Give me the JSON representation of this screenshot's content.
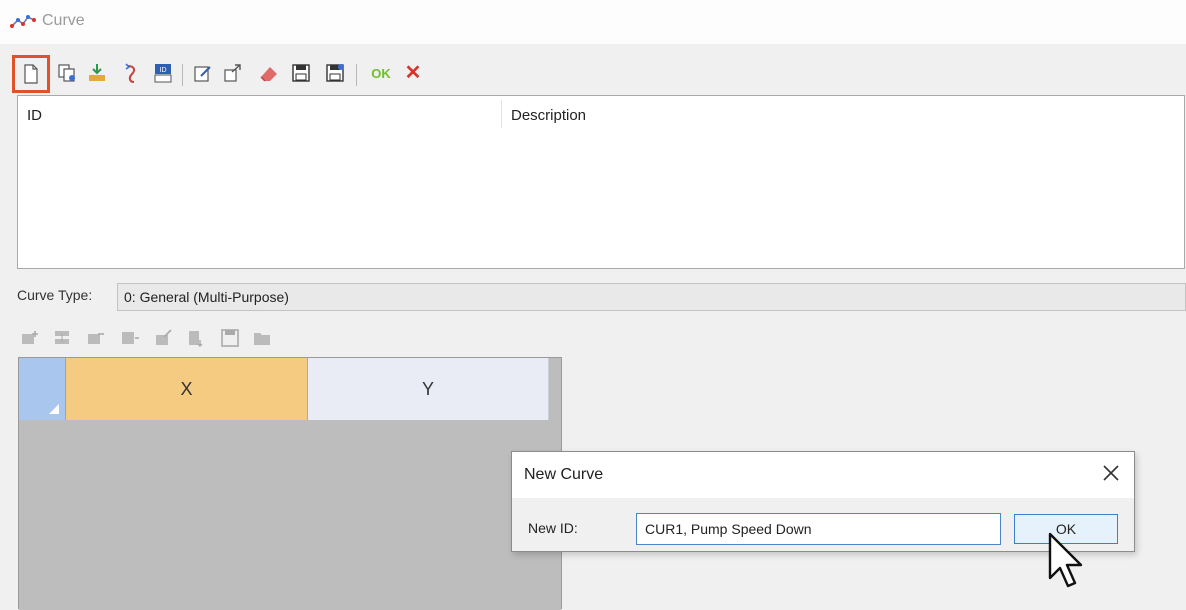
{
  "window": {
    "title": "Curve",
    "icon": "curve-chart-icon"
  },
  "toolbar": {
    "buttons": [
      {
        "name": "new-button",
        "icon": "new-document-icon"
      },
      {
        "name": "copy-button",
        "icon": "copy-icon"
      },
      {
        "name": "import-button",
        "icon": "import-icon"
      },
      {
        "name": "rename-button",
        "icon": "rename-icon"
      },
      {
        "name": "id-manager-button",
        "icon": "id-icon"
      },
      {
        "name": "edit-button",
        "icon": "edit-icon"
      },
      {
        "name": "export-button",
        "icon": "export-icon"
      },
      {
        "name": "delete-button",
        "icon": "eraser-icon"
      },
      {
        "name": "save-button",
        "icon": "save-icon"
      },
      {
        "name": "save-as-button",
        "icon": "save-as-icon"
      }
    ],
    "ok_label": "OK",
    "cancel_label": "✕"
  },
  "list": {
    "columns": [
      "ID",
      "Description"
    ]
  },
  "curve_type": {
    "label": "Curve Type:",
    "value": "0: General (Multi-Purpose)"
  },
  "grid": {
    "columns": [
      "X",
      "Y"
    ]
  },
  "dialog": {
    "title": "New Curve",
    "id_label": "New ID:",
    "id_value": "CUR1, Pump Speed Down",
    "ok_label": "OK"
  }
}
